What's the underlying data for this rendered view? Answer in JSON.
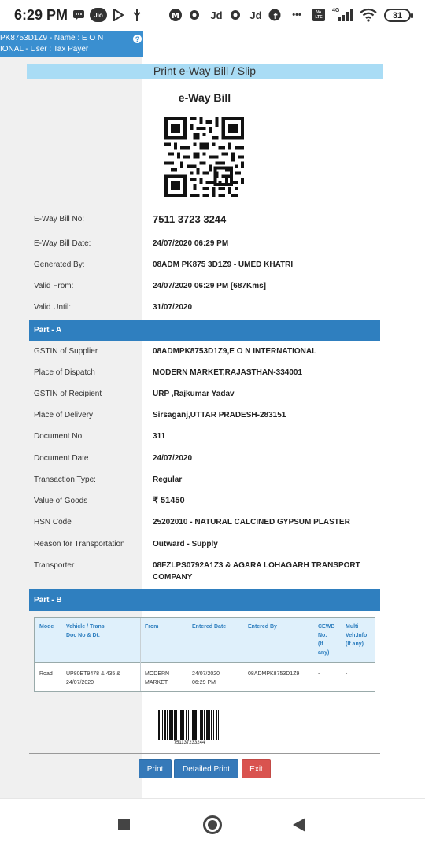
{
  "status_bar": {
    "time": "6:29 PM",
    "icons": [
      "message-icon",
      "jio-icon",
      "play-icon",
      "usb-icon",
      "app-icon",
      "sync-icon",
      "jd-icon",
      "sync-icon",
      "jd-icon",
      "facebook-icon",
      "more-icon",
      "volte-icon",
      "signal-icon",
      "wifi-icon"
    ],
    "jd_label": "Jd",
    "jio_label": "Jio",
    "volte_label": "Vo LTE",
    "network_label": "4G",
    "more_label": "•••",
    "battery": "31"
  },
  "user_strip": {
    "line1": "PK8753D1Z9 - Name : E O N",
    "line2": "IONAL - User : Tax Payer",
    "help": "?"
  },
  "title": "Print e-Way Bill / Slip",
  "heading": "e-Way Bill",
  "summary": [
    {
      "label": "E-Way Bill No:",
      "value": "7511 3723 3244"
    },
    {
      "label": "E-Way Bill Date:",
      "value": "24/07/2020 06:29 PM"
    },
    {
      "label": "Generated By:",
      "value": "08ADM PK875 3D1Z9 - UMED KHATRI"
    },
    {
      "label": "Valid From:",
      "value": "24/07/2020 06:29 PM [687Kms]"
    },
    {
      "label": "Valid Until:",
      "value": "31/07/2020"
    }
  ],
  "part_a": {
    "title": "Part - A",
    "rows": [
      {
        "label": "GSTIN of Supplier",
        "value": "08ADMPK8753D1Z9,E O N INTERNATIONAL"
      },
      {
        "label": "Place of Dispatch",
        "value": "MODERN MARKET,RAJASTHAN-334001"
      },
      {
        "label": "GSTIN of Recipient",
        "value": "URP ,Rajkumar Yadav"
      },
      {
        "label": "Place of Delivery",
        "value": "Sirsaganj,UTTAR PRADESH-283151"
      },
      {
        "label": "Document No.",
        "value": "311"
      },
      {
        "label": "Document Date",
        "value": "24/07/2020"
      },
      {
        "label": "Transaction Type:",
        "value": "Regular"
      },
      {
        "label": "Value of Goods",
        "value": "₹ 51450"
      },
      {
        "label": "HSN Code",
        "value": "25202010 - NATURAL CALCINED GYPSUM PLASTER"
      },
      {
        "label": "Reason for Transportation",
        "value": "Outward - Supply"
      },
      {
        "label": "Transporter",
        "value": "08FZLPS0792A1Z3 & AGARA LOHAGARH TRANSPORT",
        "value2": "COMPANY"
      }
    ]
  },
  "part_b": {
    "title": "Part - B",
    "headers": [
      "Mode",
      "Vehicle / Trans",
      "Doc No & Dt.",
      "From",
      "Entered Date",
      "Entered By",
      "CEWB",
      "No.",
      "(If",
      "any)",
      "Multi",
      "Veh.Info",
      "(If any)"
    ],
    "row": {
      "mode": "Road",
      "vehicle1": "UP80ET9478 & 435 &",
      "vehicle2": "24/07/2020",
      "from1": "MODERN",
      "from2": "MARKET",
      "date1": "24/07/2020",
      "date2": "06:29 PM",
      "entered_by": "08ADMPK8753D1Z9",
      "cewb": "-",
      "multi": "-"
    }
  },
  "barcode_number": "751137233244",
  "buttons": {
    "print": "Print",
    "detailed_print": "Detailed Print",
    "exit": "Exit"
  },
  "colors": {
    "header_blue": "#2f7fbf",
    "title_bar": "#a9dcf5",
    "exit_red": "#d9534f"
  }
}
